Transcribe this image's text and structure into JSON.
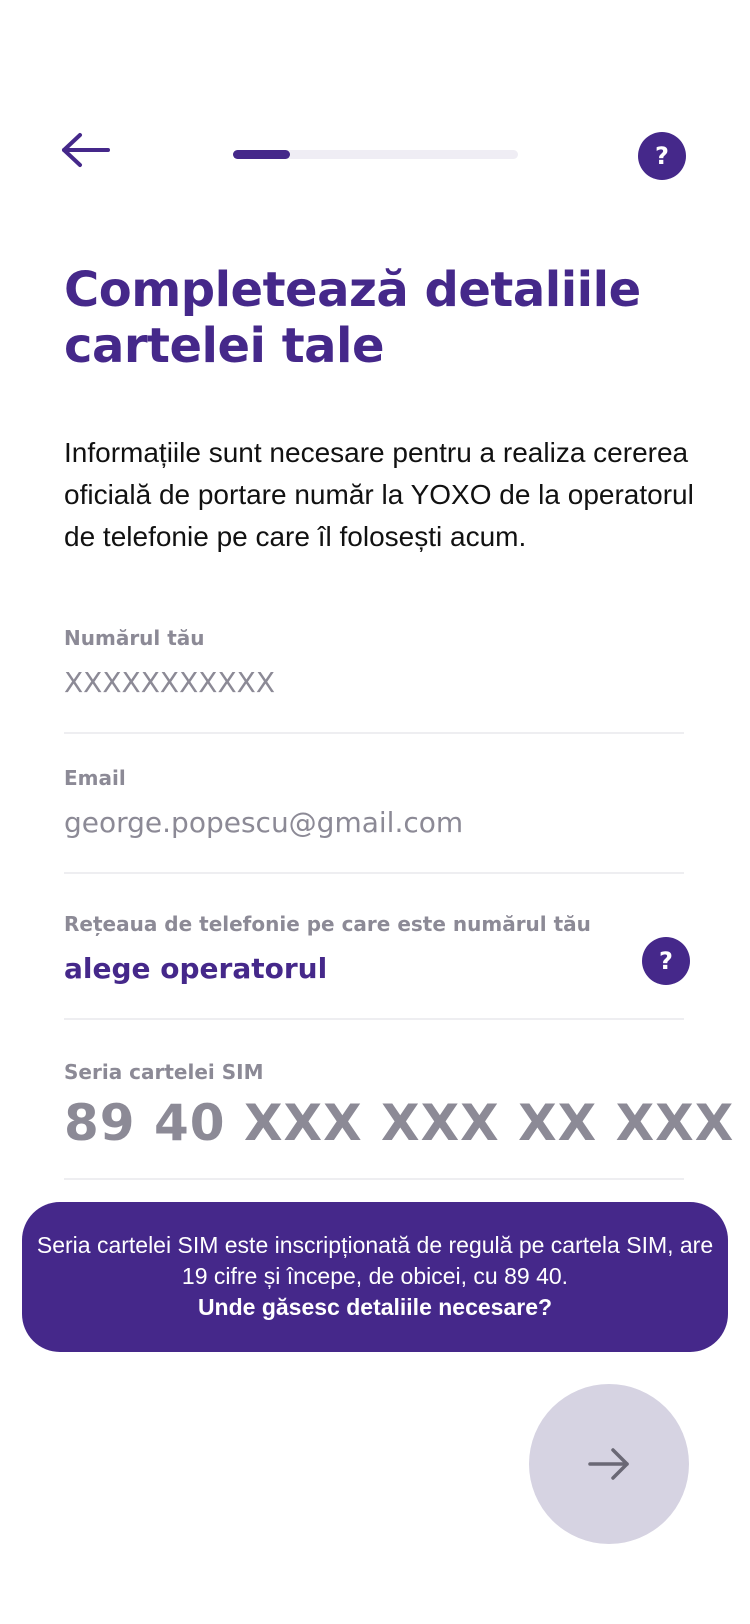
{
  "header": {
    "back_icon": "arrow-left-icon",
    "help_icon": "question-mark-icon",
    "help_label": "?",
    "progress": 0.2
  },
  "main": {
    "title": "Completează detaliile cartelei tale",
    "intro": "Informațiile sunt necesare pentru a realiza cererea oficială de portare număr la YOXO de la operatorul de telefonie pe care îl folosești acum."
  },
  "form": {
    "phone_number": {
      "label": "Numărul tău",
      "placeholder": "XXXXXXXXXXX"
    },
    "email": {
      "label": "Email",
      "placeholder": "george.popescu@gmail.com"
    },
    "network": {
      "label": "Rețeaua de telefonie pe care este numărul tău",
      "value": "alege operatorul",
      "help_label": "?"
    },
    "sim_serial": {
      "label": "Seria cartelei SIM",
      "placeholder": "89 40 XXX XXX XX XXX"
    }
  },
  "info": {
    "text": "Seria cartelei SIM este inscripționată de regulă pe cartela SIM, are 19 cifre și începe, de obicei, cu 89 40.",
    "link": "Unde găsesc detaliile necesare?"
  },
  "next_button": {
    "icon": "arrow-right-icon"
  },
  "colors": {
    "brand": "#45288a",
    "muted_text": "#8c8a96",
    "track": "#efedf4",
    "next_disabled": "#d6d3e2"
  }
}
